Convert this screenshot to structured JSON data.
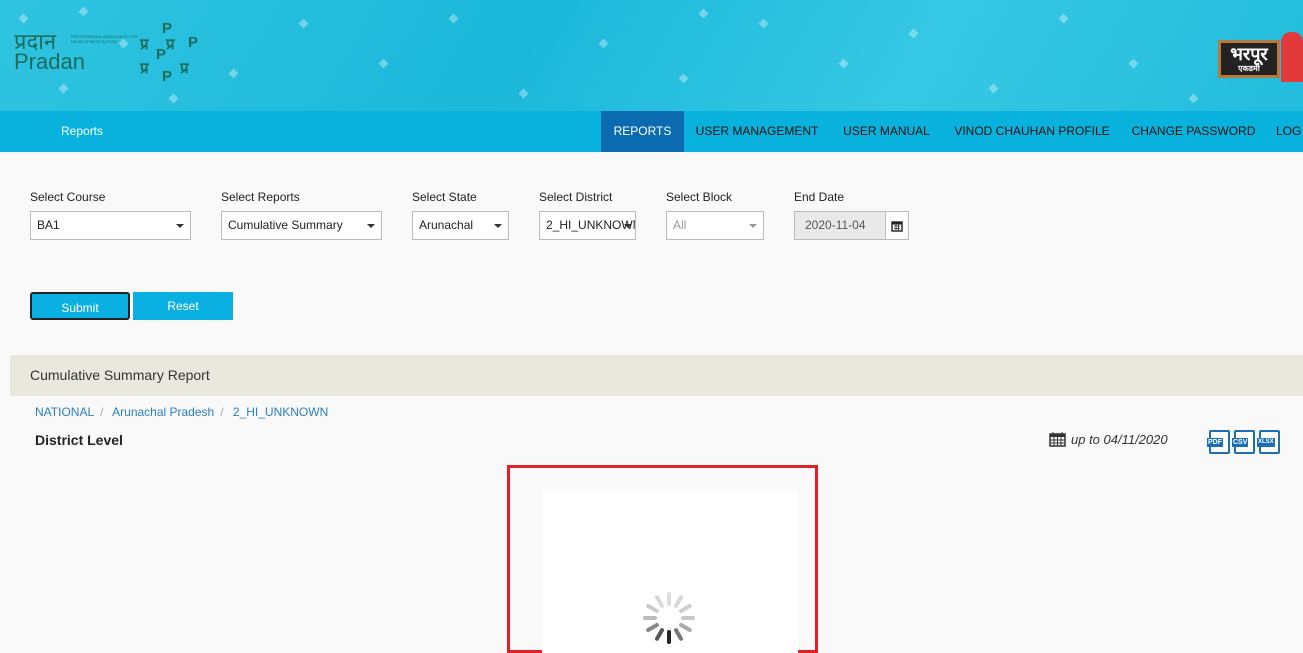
{
  "header": {
    "logo_left_hindi": "प्रदान",
    "logo_left": "Pradan",
    "logo_left_tagline": "PROFESSIONAL ASSISTANCE FOR DEVELOPMENT ACTION",
    "logo_right_hindi": "भरपूर",
    "logo_right_sub": "एकडमी"
  },
  "nav": {
    "title": "Reports",
    "items": [
      {
        "label": "REPORTS",
        "active": true
      },
      {
        "label": "USER MANAGEMENT"
      },
      {
        "label": "USER MANUAL"
      },
      {
        "label": "VINOD CHAUHAN PROFILE"
      },
      {
        "label": "CHANGE PASSWORD"
      },
      {
        "label": "LOG"
      }
    ]
  },
  "filters": {
    "course": {
      "label": "Select Course",
      "value": "BA1"
    },
    "reports": {
      "label": "Select Reports",
      "value": "Cumulative Summary"
    },
    "state": {
      "label": "Select State",
      "value": "Arunachal"
    },
    "district": {
      "label": "Select District",
      "value": "2_HI_UNKNOWN"
    },
    "block": {
      "label": "Select Block",
      "value": "All"
    },
    "end_date": {
      "label": "End Date",
      "value": "2020-11-04"
    }
  },
  "buttons": {
    "submit": "Submit",
    "reset": "Reset"
  },
  "report": {
    "title": "Cumulative Summary Report",
    "breadcrumb": [
      "NATIONAL",
      "Arunachal Pradesh",
      "2_HI_UNKNOWN"
    ],
    "level": "District Level",
    "up_to": "up to 04/11/2020",
    "exports": [
      "PDF",
      "CSV",
      "XLSX"
    ]
  },
  "colors": {
    "nav": "#08b2dc",
    "active": "#0a6bb0",
    "button": "#0bb0e2",
    "highlight": "#e0202a"
  }
}
